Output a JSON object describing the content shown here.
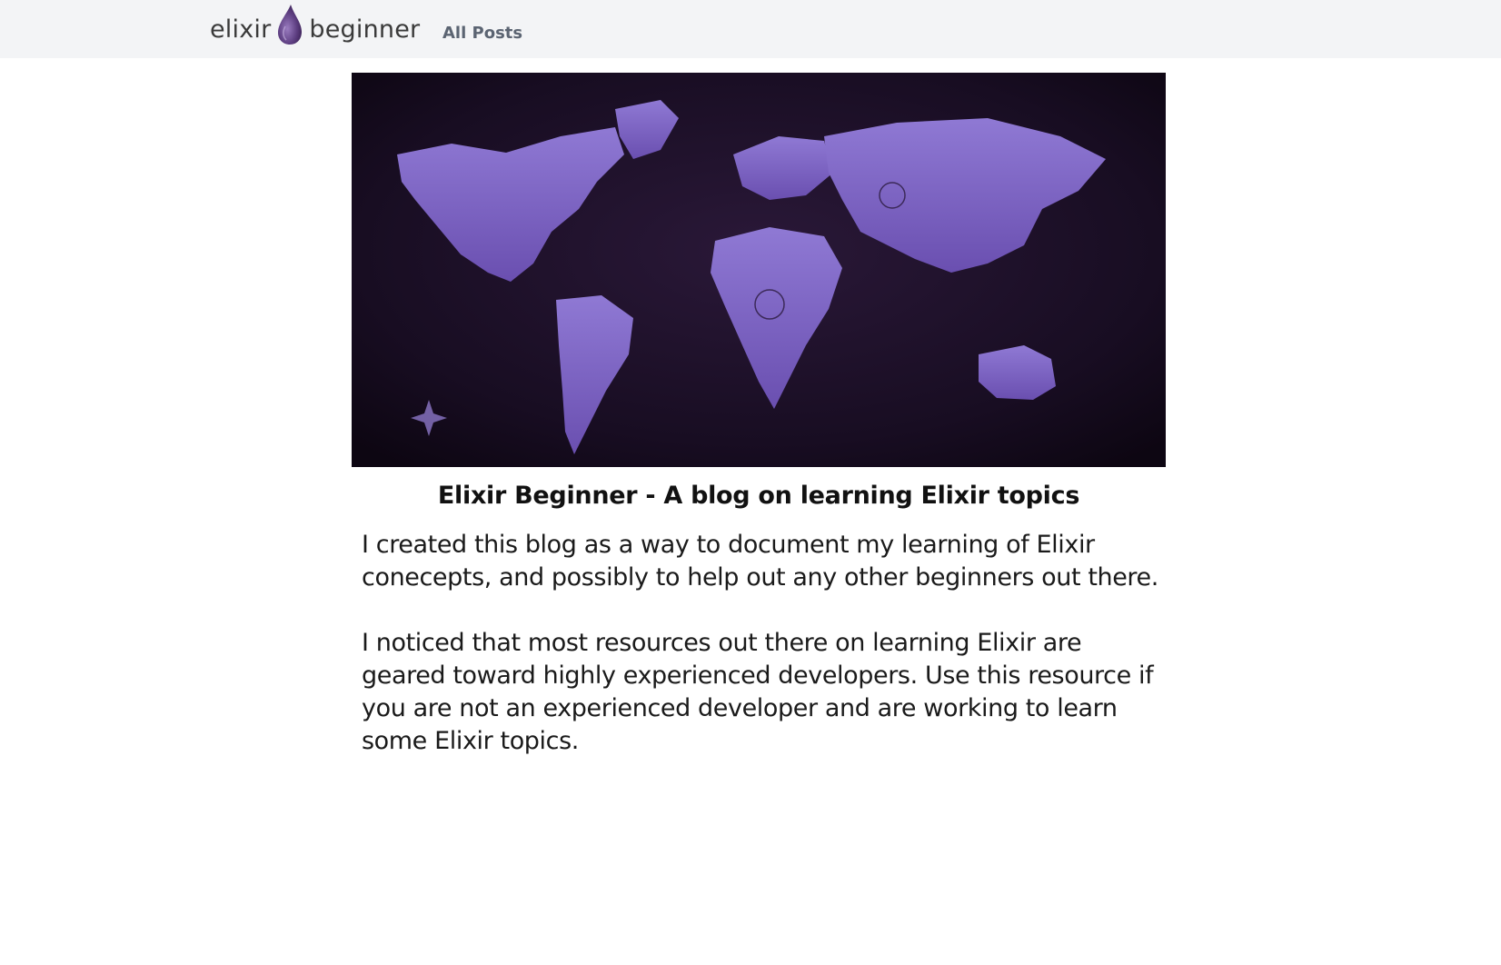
{
  "nav": {
    "brand_left": "elixir",
    "brand_right": "beginner",
    "links": [
      {
        "label": "All Posts"
      }
    ]
  },
  "colors": {
    "nav_bg": "#f3f4f6",
    "drop_purple": "#6b4a8c",
    "map_purple": "#7b5fc4",
    "map_bg": "#140b1c"
  },
  "icons": {
    "brand_drop": "elixir-drop-logo"
  },
  "post": {
    "title": "Elixir Beginner - A blog on learning Elixir topics",
    "paragraphs": [
      "I created this blog as a way to document my learning of Elixir conecepts, and possibly to help out any other beginners out there.",
      "I noticed that most resources out there on learning Elixir are geared toward highly experienced developers. Use this resource if you are not an experienced developer and are working to learn some Elixir topics."
    ]
  }
}
